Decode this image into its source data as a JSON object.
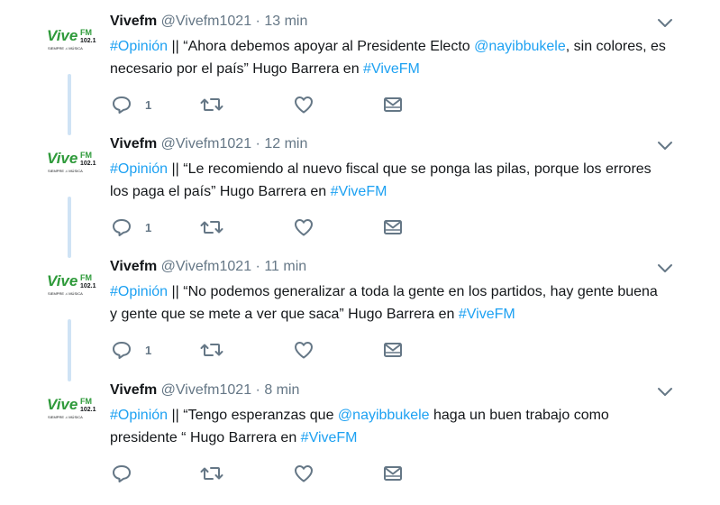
{
  "colors": {
    "link": "#1da1f2",
    "muted": "#657786",
    "thread": "#cfe3f5",
    "logo_green": "#2e9a3a"
  },
  "logo": {
    "word": "Vive",
    "fm": "FM",
    "freq": "102.1",
    "tagline": "SIEMPRE ♫ MÚSICA"
  },
  "tweets": [
    {
      "name": "Vivefm",
      "handle": "@Vivefm1021",
      "dot": "·",
      "time": "13 min",
      "segments": [
        {
          "t": "#Opinión",
          "link": true
        },
        {
          "t": " || “Ahora debemos apoyar al Presidente Electo ",
          "link": false
        },
        {
          "t": "@nayibbukele",
          "link": true
        },
        {
          "t": ", sin colores, es necesario por el país” Hugo Barrera en ",
          "link": false
        },
        {
          "t": "#ViveFM",
          "link": true
        }
      ],
      "reply_count": "1"
    },
    {
      "name": "Vivefm",
      "handle": "@Vivefm1021",
      "dot": "·",
      "time": "12 min",
      "segments": [
        {
          "t": "#Opinión",
          "link": true
        },
        {
          "t": " || “Le recomiendo al nuevo fiscal que se ponga las pilas, porque los errores los paga el país” Hugo Barrera en ",
          "link": false
        },
        {
          "t": "#ViveFM",
          "link": true
        }
      ],
      "reply_count": "1"
    },
    {
      "name": "Vivefm",
      "handle": "@Vivefm1021",
      "dot": "·",
      "time": "11 min",
      "segments": [
        {
          "t": "#Opinión",
          "link": true
        },
        {
          "t": " || “No podemos generalizar a toda la gente en los partidos, hay gente buena y gente que se mete a ver que saca” Hugo Barrera en ",
          "link": false
        },
        {
          "t": "#ViveFM",
          "link": true
        }
      ],
      "reply_count": "1"
    },
    {
      "name": "Vivefm",
      "handle": "@Vivefm1021",
      "dot": "·",
      "time": "8 min",
      "segments": [
        {
          "t": "#Opinión",
          "link": true
        },
        {
          "t": " || “Tengo esperanzas que ",
          "link": false
        },
        {
          "t": "@nayibbukele",
          "link": true
        },
        {
          "t": " haga un buen trabajo como presidente “ Hugo Barrera en ",
          "link": false
        },
        {
          "t": "#ViveFM",
          "link": true
        }
      ],
      "reply_count": ""
    }
  ]
}
